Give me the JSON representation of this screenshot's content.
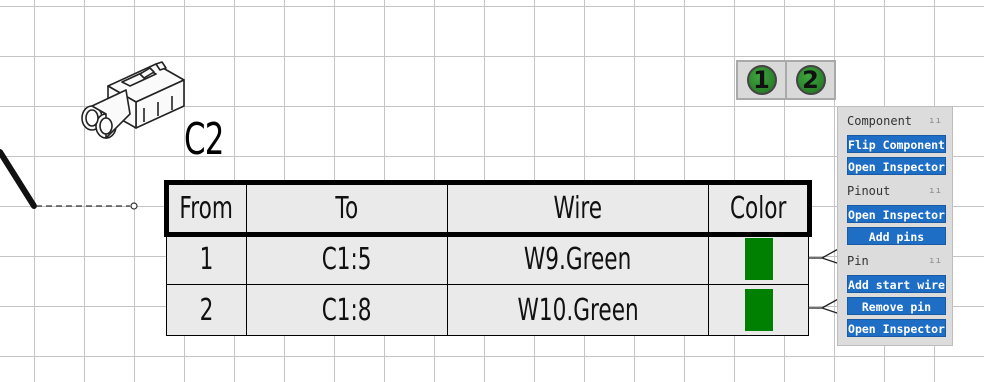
{
  "component": {
    "designator": "C2"
  },
  "pinout": {
    "headers": [
      "From",
      "To",
      "Wire",
      "Color"
    ],
    "rows": [
      {
        "from": "1",
        "to": "C1:5",
        "wire": "W9.Green",
        "color": "#008000"
      },
      {
        "from": "2",
        "to": "C1:8",
        "wire": "W10.Green",
        "color": "#008000"
      }
    ]
  },
  "pin_badges": [
    "1",
    "2"
  ],
  "menu": {
    "sections": [
      {
        "title": "Component",
        "buttons": [
          "Flip Component",
          "Open Inspector"
        ]
      },
      {
        "title": "Pinout",
        "buttons": [
          "Open Inspector",
          "Add pins"
        ]
      },
      {
        "title": "Pin",
        "buttons": [
          "Add start wire",
          "Remove pin",
          "Open Inspector"
        ]
      }
    ],
    "grip_icon": "drag-handle-icon"
  },
  "colors": {
    "wire_swatch": "#008000",
    "menu_button": "#1f6ec5",
    "badge": "#2e8b2e"
  }
}
